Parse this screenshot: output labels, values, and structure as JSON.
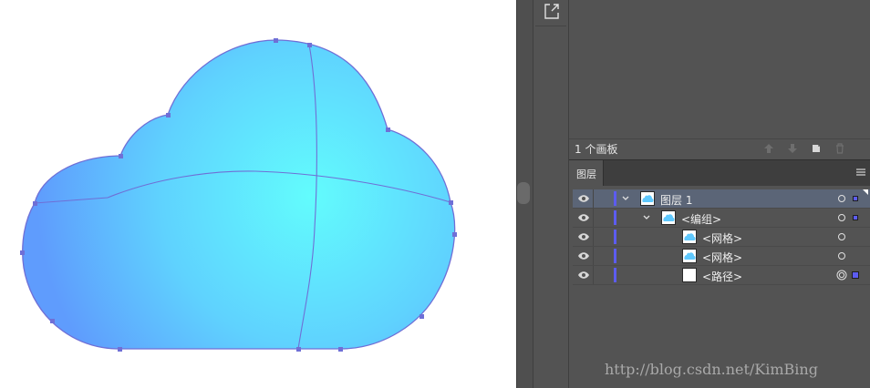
{
  "canvas": {
    "artwork": "cloud-icon",
    "gradient_center_color": "#62fcfd",
    "gradient_edge_color": "#60a8fe",
    "path_color": "#6f6fd6"
  },
  "toolstrip": {
    "export_icon": "export-icon"
  },
  "artboards": {
    "count_label": "1 个画板"
  },
  "layers_panel": {
    "tab_label": "图层",
    "rows": [
      {
        "name": "图层 1",
        "expanded": true,
        "selected": true
      },
      {
        "name": "<编组>",
        "expanded": true,
        "selected": false
      },
      {
        "name": "<网格>",
        "selected": false
      },
      {
        "name": "<网格>",
        "selected": false
      },
      {
        "name": "<路径>",
        "selected": false
      }
    ]
  },
  "watermark": "http://blog.csdn.net/KimBing",
  "colors": {
    "layer_color": "#5c5cf0",
    "selected_row": "#5b6577",
    "panel_bg": "#535353"
  }
}
